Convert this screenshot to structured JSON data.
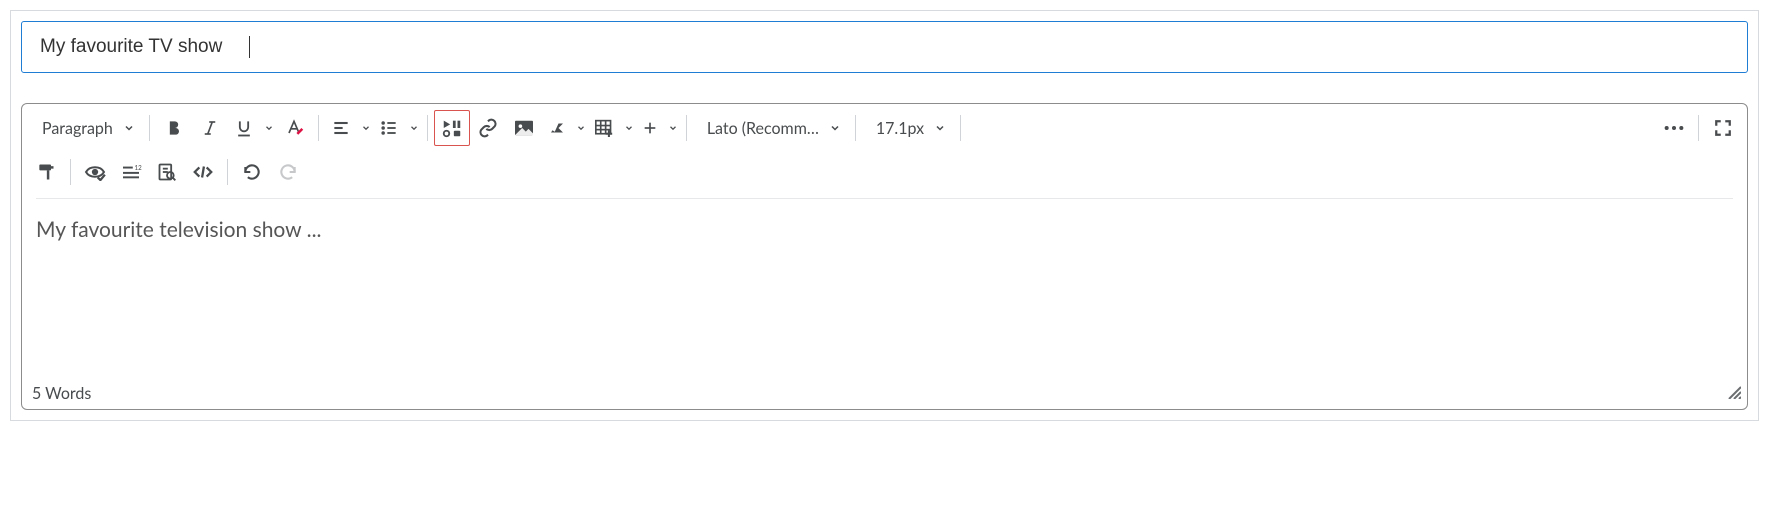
{
  "title": {
    "value": "My favourite TV show"
  },
  "toolbar": {
    "format_block": "Paragraph",
    "font_family": "Lato (Recomm…",
    "font_size": "17.1px"
  },
  "content": {
    "text": "My favourite television show ..."
  },
  "footer": {
    "word_count": "5 Words"
  }
}
